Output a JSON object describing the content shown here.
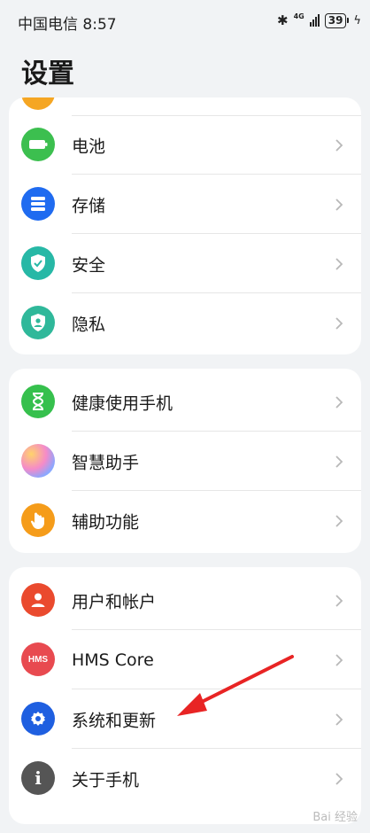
{
  "status_bar": {
    "carrier_time": "中国电信 8:57",
    "network": "4G",
    "battery": "39"
  },
  "header": {
    "title": "设置"
  },
  "groups": [
    {
      "items": [
        {
          "label": "电池",
          "icon": "battery-icon",
          "color": "#3cbf4f"
        },
        {
          "label": "存储",
          "icon": "storage-icon",
          "color": "#1f6bf0"
        },
        {
          "label": "安全",
          "icon": "shield-icon",
          "color": "#27b8a6"
        },
        {
          "label": "隐私",
          "icon": "privacy-icon",
          "color": "#2fb89a"
        }
      ]
    },
    {
      "items": [
        {
          "label": "健康使用手机",
          "icon": "hourglass-icon",
          "color": "#36c04d"
        },
        {
          "label": "智慧助手",
          "icon": "assistant-icon",
          "color": "#c78ee6"
        },
        {
          "label": "辅助功能",
          "icon": "hand-icon",
          "color": "#f59c1a"
        }
      ]
    },
    {
      "items": [
        {
          "label": "用户和帐户",
          "icon": "user-icon",
          "color": "#ea4a2e"
        },
        {
          "label": "HMS Core",
          "icon": "hms-icon",
          "color": "#e84a50",
          "icon_text": "HMS"
        },
        {
          "label": "系统和更新",
          "icon": "gear-icon",
          "color": "#1f5fe0"
        },
        {
          "label": "关于手机",
          "icon": "info-icon",
          "color": "#555555",
          "icon_text": "i"
        }
      ]
    }
  ],
  "watermark": "Bai 经验"
}
